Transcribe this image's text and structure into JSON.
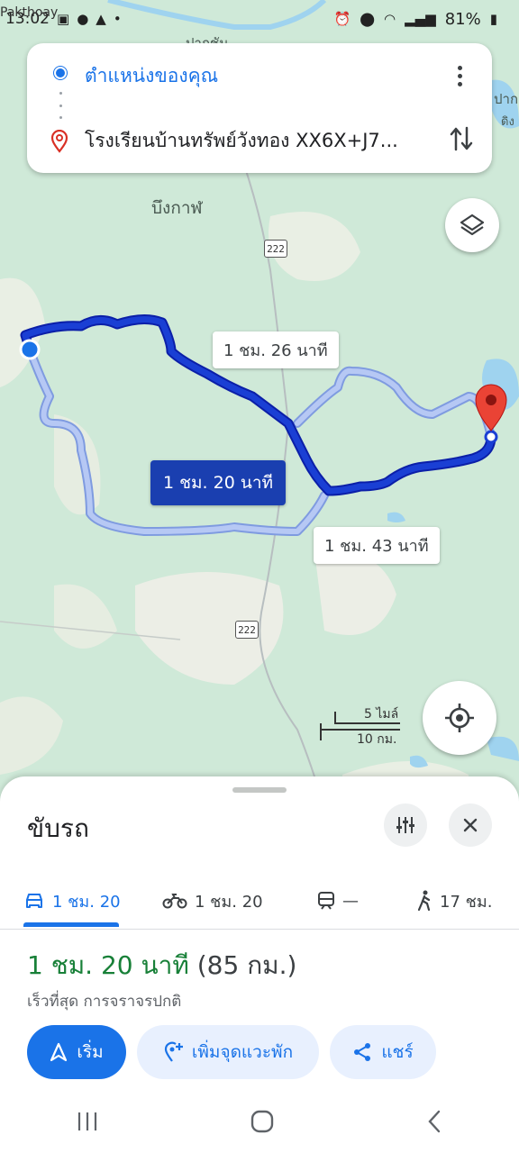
{
  "status_bar": {
    "time": "13:02",
    "carrier_overlay": "Pakthoay",
    "battery": "81%"
  },
  "search": {
    "origin": "ตำแหน่งของคุณ",
    "destination": "โรงเรียนบ้านทรัพย์วังทอง XX6X+J7..."
  },
  "map": {
    "place_labels": [
      "ปากชัน",
      "บึงกาฬ",
      "ปาก",
      "ดิง"
    ],
    "road_number": "222",
    "route_labels": {
      "primary": "1 ชม. 20 นาที",
      "alt1": "1 ชม. 26 นาที",
      "alt2": "1 ชม. 43 นาที"
    },
    "scale": {
      "miles": "5 ไมล์",
      "km": "10 กม."
    },
    "colors": {
      "route_primary": "#1a3fd4",
      "route_alt": "#a9bdf2",
      "water": "#9fd3ef",
      "land": "#cfe9d8",
      "pin": "#ea4335"
    }
  },
  "sheet": {
    "title": "ขับรถ",
    "tabs": [
      {
        "mode": "car",
        "label": "1 ชม. 20"
      },
      {
        "mode": "motorcycle",
        "label": "1 ชม. 20"
      },
      {
        "mode": "transit",
        "label": "—"
      },
      {
        "mode": "walk",
        "label": "17 ชม."
      }
    ],
    "duration": "1 ชม. 20 นาที",
    "distance": "(85 กม.)",
    "subtitle": "เร็วที่สุด การจราจรปกติ",
    "buttons": {
      "start": "เริ่ม",
      "add_stop": "เพิ่มจุดแวะพัก",
      "share": "แชร์"
    }
  }
}
